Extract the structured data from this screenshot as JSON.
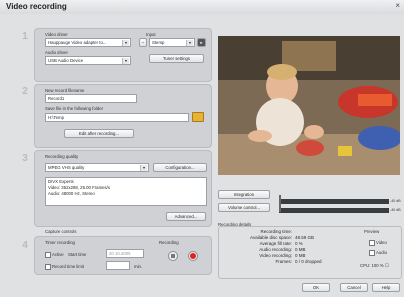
{
  "window": {
    "title": "Video recording",
    "close": "×"
  },
  "steps": [
    "1",
    "2",
    "3",
    "4"
  ],
  "source": {
    "video_driver_label": "Video driver",
    "video_driver_value": "Hauppauge Video adapter to...",
    "input_label": "Input",
    "input_value": "Stemp",
    "audio_driver_label": "Audio driver",
    "audio_driver_value": "USB Audio Device",
    "tuner_settings": "Tuner settings"
  },
  "file": {
    "name_label": "New record filename",
    "name_value": "Record1",
    "folder_label": "Save file in the following folder",
    "folder_value": "H:\\Temp",
    "edit_after": "Edit after recording..."
  },
  "quality": {
    "label": "Recording quality",
    "value": "MPEG VHS quality",
    "configuration": "Configuration...",
    "details": [
      "DIVX Experts",
      "Video: 352x288, 25.00 Frames/s",
      "Audio: 48000 Hz, Stereo"
    ],
    "advanced": "Advanced..."
  },
  "capture": {
    "section_label": "Capture controls",
    "timer_label": "Timer recording",
    "recording_label": "Recording",
    "active_label": "Active",
    "start_label": "Start time",
    "start_value": "20.10.2005",
    "record_for_label": "Record time limit",
    "record_for_unit": "min."
  },
  "side": {
    "integration": "Integration",
    "volume_control": "Volume control...",
    "meter_left": "-40 dB",
    "meter_right": "-40 dB"
  },
  "details": {
    "section_label": "Recording details",
    "rows": [
      {
        "k": "Recording time:",
        "v": ""
      },
      {
        "k": "Available disc space:",
        "v": "48.59 GB"
      },
      {
        "k": "Average fill rate:",
        "v": "0 %"
      },
      {
        "k": "Audio recording:",
        "v": "0 MB"
      },
      {
        "k": "Video recording:",
        "v": "0 MB"
      },
      {
        "k": "Frames:",
        "v": "0 / 0 dropped"
      }
    ],
    "preview_label": "Preview",
    "preview_video": "Video",
    "preview_audio": "Audio",
    "cpu": "CPU: 100 % ☐"
  },
  "footer": {
    "ok": "OK",
    "cancel": "Cancel",
    "help": "Help"
  },
  "colors": {
    "record": "#e2231a",
    "panel": "#cfd1d4"
  }
}
